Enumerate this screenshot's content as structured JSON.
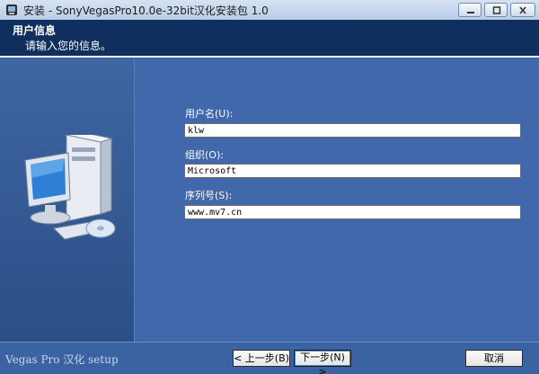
{
  "window": {
    "title": "安装 - SonyVegasPro10.0e-32bit汉化安装包 1.0",
    "icon": "installer-icon"
  },
  "header": {
    "title": "用户信息",
    "subtitle": "请输入您的信息。"
  },
  "form": {
    "username": {
      "label": "用户名(U):",
      "value": "klw"
    },
    "organization": {
      "label": "组织(O):",
      "value": "Microsoft"
    },
    "serial": {
      "label": "序列号(S):",
      "value": "www.mv7.cn"
    }
  },
  "footer": {
    "brand": "Vegas Pro 汉化 setup",
    "back_label": "< 上一步(B)",
    "next_label": "下一步(N) >",
    "cancel_label": "取消"
  },
  "colors": {
    "header_bg": "#0f2f5e",
    "panel_bg": "#4068aa",
    "left_panel_bg": "#3f66a3"
  }
}
